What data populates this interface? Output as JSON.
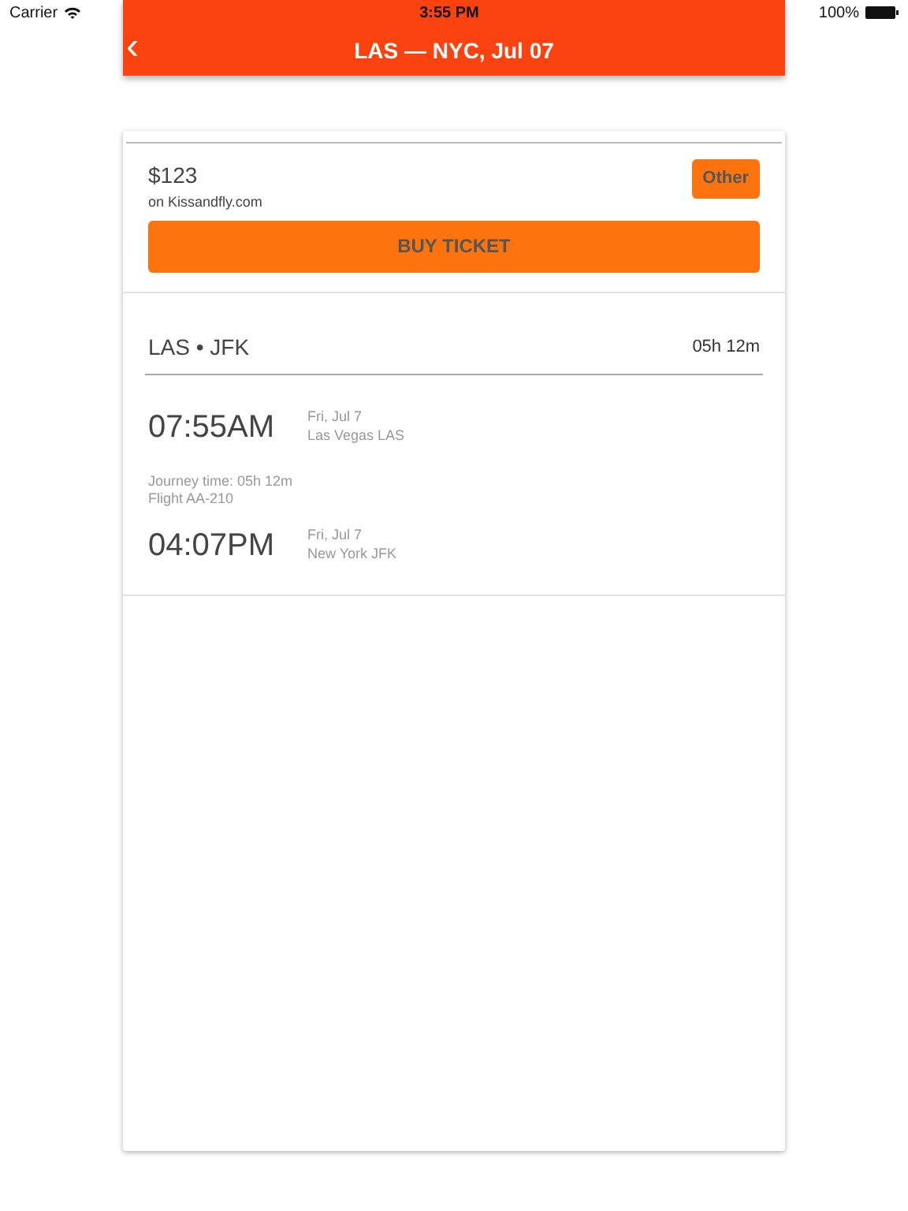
{
  "status_bar": {
    "carrier": "Carrier",
    "time": "3:55 PM",
    "battery": "100%"
  },
  "header": {
    "back": "‹",
    "title": "LAS — NYC, Jul 07"
  },
  "offer": {
    "price": "$123",
    "source": "on Kissandfly.com",
    "tag": "Other",
    "buy": "BUY TICKET"
  },
  "route": {
    "title": "LAS • JFK",
    "duration": "05h 12m"
  },
  "segments": [
    {
      "kind": "stop",
      "time": "07:55AM",
      "date": "Fri, Jul 7",
      "place": "Las Vegas LAS"
    },
    {
      "kind": "info",
      "lines": [
        "Journey time: 05h 12m",
        "Flight AA-210"
      ]
    },
    {
      "kind": "stop",
      "time": "04:07PM",
      "date": "Fri, Jul 7",
      "place": "New York JFK"
    }
  ]
}
